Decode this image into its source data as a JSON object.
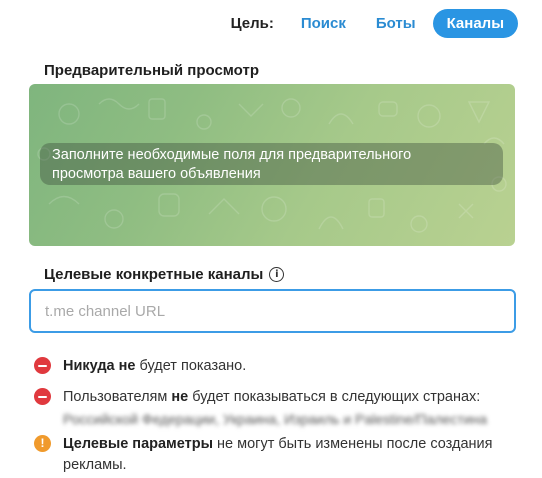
{
  "targeting": {
    "label": "Цель:",
    "options": [
      "Поиск",
      "Боты",
      "Каналы"
    ],
    "active_index": 2
  },
  "preview": {
    "title": "Предварительный просмотр",
    "message_line1": "Заполните необходимые поля для предварительного",
    "message_line2": "просмотра вашего объявления"
  },
  "channels": {
    "title": "Целевые конкретные каналы",
    "info_icon": "info-icon",
    "input_placeholder": "t.me channel URL",
    "input_value": ""
  },
  "notices": [
    {
      "icon": "minus-circle-icon",
      "bold": "Никуда не",
      "text": " будет показано."
    },
    {
      "icon": "minus-circle-icon",
      "text_before": "Пользователям ",
      "bold": "не",
      "text_after": " будет показываться в следующих странах:",
      "countries_blurred": "Российской Федерации, Украина, Израиль и Palestine/Палестина"
    },
    {
      "icon": "exclamation-circle-icon",
      "bold": "Целевые параметры",
      "text": " не могут быть изменены после создания рекламы."
    }
  ],
  "colors": {
    "accent": "#2a95e3",
    "error": "#e0393e",
    "warning": "#f09a2c"
  }
}
